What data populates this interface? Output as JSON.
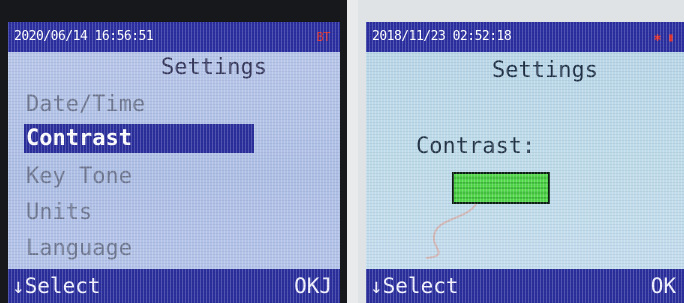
{
  "left_device": {
    "status": {
      "datetime": "2020/06/14 16:56:51",
      "indicator": "BT"
    },
    "title": "Settings",
    "menu": [
      {
        "label": "Date/Time",
        "selected": false
      },
      {
        "label": "Contrast",
        "selected": true
      },
      {
        "label": "Key Tone",
        "selected": false
      },
      {
        "label": "Units",
        "selected": false
      },
      {
        "label": "Language",
        "selected": false
      }
    ],
    "softkeys": {
      "left": "↓Select",
      "right": "OKJ"
    }
  },
  "right_device": {
    "status": {
      "datetime": "2018/11/23 02:52:18"
    },
    "title": "Settings",
    "contrast_label": "Contrast:",
    "contrast_level": 1.0,
    "softkeys": {
      "left": "↓Select",
      "right": "OK"
    }
  },
  "colors": {
    "bar": "#2a2f9c",
    "bt": "#e0322e",
    "contrast_fill": "#54d84c"
  }
}
